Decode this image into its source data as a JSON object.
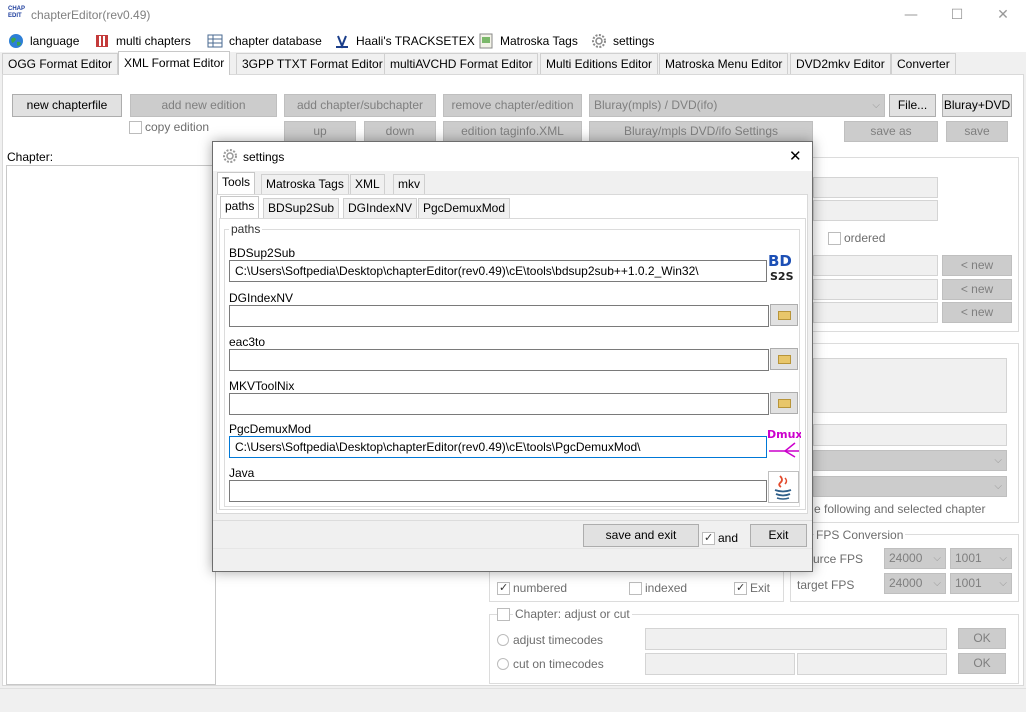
{
  "window": {
    "title": "chapterEditor(rev0.49)",
    "app_icon_text": [
      "CHAP",
      "EDIT"
    ],
    "minimize": "—",
    "maximize": "☐",
    "close": "✕"
  },
  "menubar": {
    "items": [
      {
        "label": "language",
        "icon": "globe-icon"
      },
      {
        "label": "multi chapters",
        "icon": "book-icon"
      },
      {
        "label": "chapter database",
        "icon": "table-icon"
      },
      {
        "label": "Haali's TRACKSETEX",
        "icon": "haali-icon"
      },
      {
        "label": "Matroska Tags",
        "icon": "tag-doc-icon"
      },
      {
        "label": "settings",
        "icon": "gear-icon"
      }
    ]
  },
  "format_tabs": [
    "OGG Format Editor",
    "XML Format Editor",
    "3GPP TTXT Format Editor",
    "multiAVCHD Format Editor",
    "Multi Editions Editor",
    "Matroska Menu Editor",
    "DVD2mkv Editor",
    "Converter"
  ],
  "toolbar": {
    "new_chapterfile": "new chapterfile",
    "add_new_edition": "add new edition",
    "add_chapter": "add chapter/subchapter",
    "remove_chapter": "remove chapter/edition",
    "source_select": "Bluray(mpls) / DVD(ifo)",
    "file": "File...",
    "bluray_dvd": "Bluray+DVD",
    "copy_edition": "copy edition",
    "up": "up",
    "down": "down",
    "edition_taginfo": "edition taginfo.XML",
    "bluray_settings": "Bluray/mpls DVD/ifo Settings",
    "save_as": "save as",
    "save": "save"
  },
  "left": {
    "chapter_label": "Chapter:"
  },
  "right": {
    "ordered": "ordered",
    "new_btn": "< new",
    "following_text": "e following and selected chapter",
    "fps_title": "FPS Conversion",
    "source_fps": "urce FPS",
    "target_fps": "target FPS",
    "fps_val": "24000",
    "fps_den": "1001"
  },
  "bottom": {
    "numbered": "numbered",
    "indexed": "indexed",
    "exit": "Exit",
    "adjust_title": "Chapter: adjust or cut",
    "adjust_timecodes": "adjust timecodes",
    "cut_timecodes": "cut on timecodes",
    "ok": "OK"
  },
  "dialog": {
    "title": "settings",
    "close": "✕",
    "tabs": [
      "Tools",
      "Matroska Tags",
      "XML",
      "mkv"
    ],
    "subtabs": [
      "paths",
      "BDSup2Sub",
      "DGIndexNV",
      "PgcDemuxMod"
    ],
    "group_label": "paths",
    "fields": [
      {
        "label": "BDSup2Sub",
        "value": "C:\\Users\\Softpedia\\Desktop\\chapterEditor(rev0.49)\\cE\\tools\\bdsup2sub++1.0.2_Win32\\",
        "logo": "BD S2S"
      },
      {
        "label": "DGIndexNV",
        "value": ""
      },
      {
        "label": "eac3to",
        "value": ""
      },
      {
        "label": "MKVToolNix",
        "value": ""
      },
      {
        "label": "PgcDemuxMod",
        "value": "C:\\Users\\Softpedia\\Desktop\\chapterEditor(rev0.49)\\cE\\tools\\PgcDemuxMod\\",
        "logo": "Dmux"
      },
      {
        "label": "Java",
        "value": ""
      }
    ],
    "save_and_exit": "save and exit",
    "and_label": "and",
    "exit": "Exit"
  },
  "colors": {
    "accent_focus": "#0078d7",
    "bd_logo_blue": "#1c4fb5",
    "dmux_magenta": "#cc00cc"
  }
}
